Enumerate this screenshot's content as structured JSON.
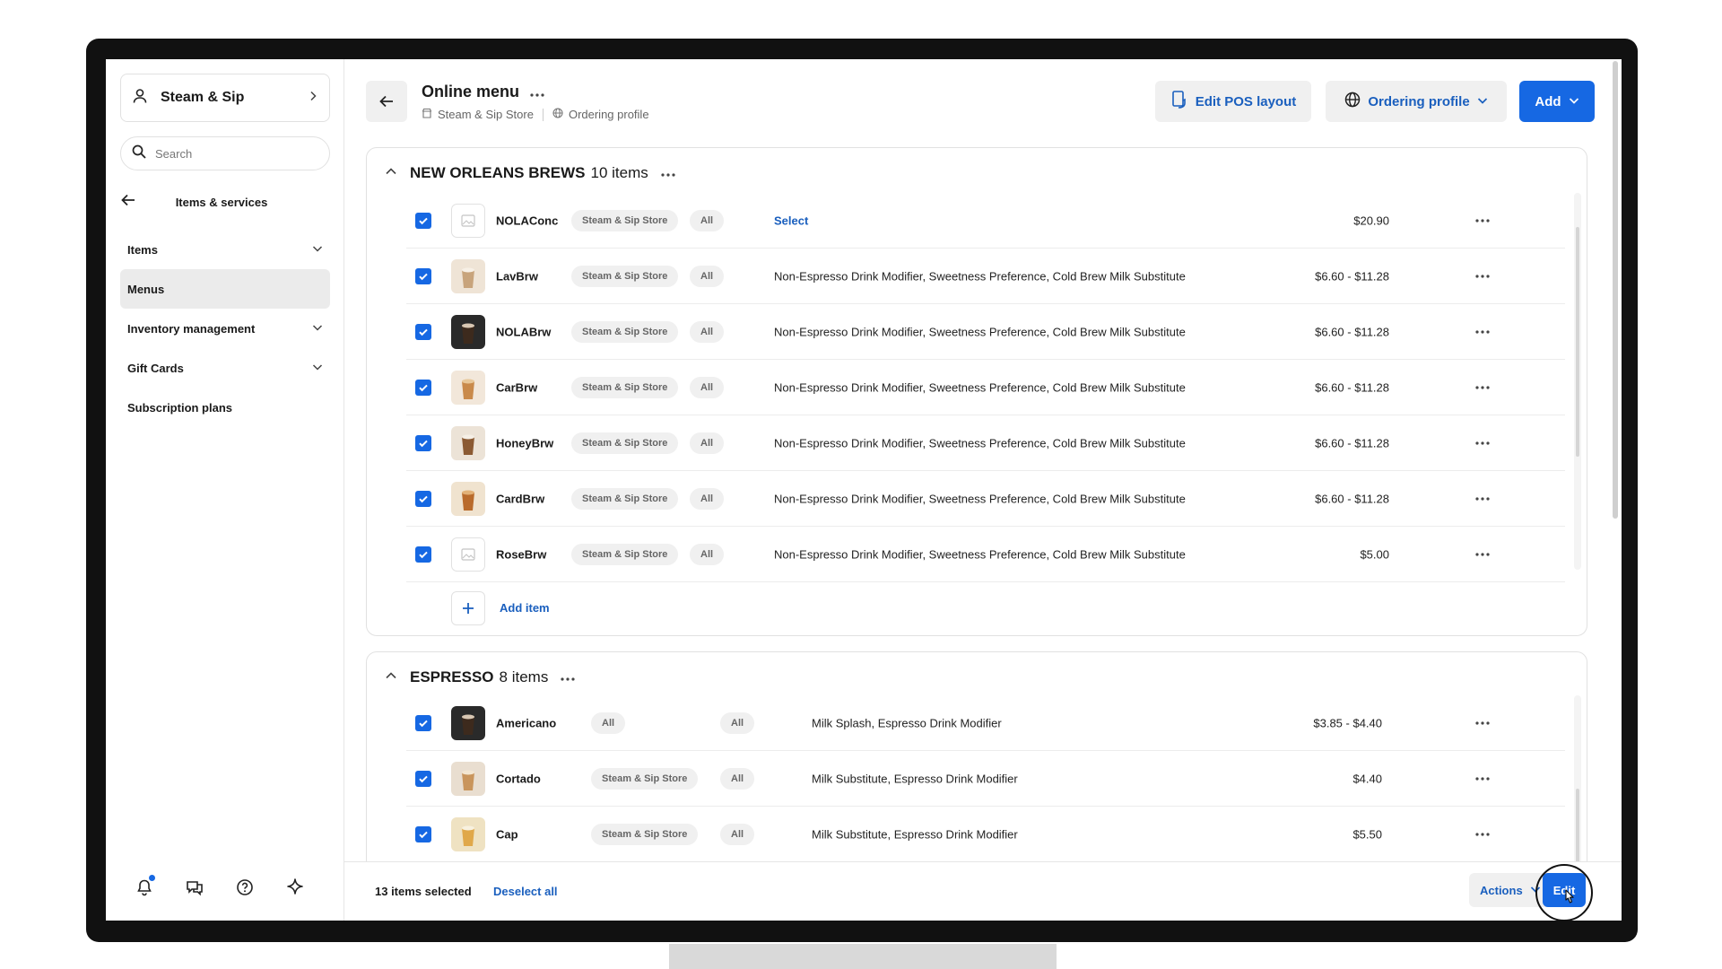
{
  "sidebar": {
    "account_name": "Steam & Sip",
    "search_placeholder": "Search",
    "section_title": "Items & services",
    "nav": [
      {
        "label": "Items",
        "has_chevron": true
      },
      {
        "label": "Menus",
        "has_chevron": false,
        "active": true
      },
      {
        "label": "Inventory management",
        "has_chevron": true
      },
      {
        "label": "Gift Cards",
        "has_chevron": true
      },
      {
        "label": "Subscription plans",
        "has_chevron": false
      }
    ]
  },
  "header": {
    "title": "Online menu",
    "crumb_location": "Steam & Sip Store",
    "crumb_profile": "Ordering profile",
    "edit_pos_label": "Edit POS layout",
    "ordering_profile_label": "Ordering profile",
    "add_label": "Add"
  },
  "sections": [
    {
      "name": "NEW ORLEANS BREWS",
      "count": "10 items",
      "add_item_label": "Add item",
      "rows": [
        {
          "name": "NOLAConc",
          "location": "Steam & Sip Store",
          "visibility": "All",
          "modifiers": "Select",
          "modifiers_is_link": true,
          "price": "$20.90",
          "thumb": "placeholder"
        },
        {
          "name": "LavBrw",
          "location": "Steam & Sip Store",
          "visibility": "All",
          "modifiers": "Non-Espresso Drink Modifier, Sweetness Preference, Cold Brew Milk Substitute",
          "price": "$6.60 - $11.28",
          "thumb": "latte"
        },
        {
          "name": "NOLABrw",
          "location": "Steam & Sip Store",
          "visibility": "All",
          "modifiers": "Non-Espresso Drink Modifier, Sweetness Preference, Cold Brew Milk Substitute",
          "price": "$6.60 - $11.28",
          "thumb": "dark"
        },
        {
          "name": "CarBrw",
          "location": "Steam & Sip Store",
          "visibility": "All",
          "modifiers": "Non-Espresso Drink Modifier, Sweetness Preference, Cold Brew Milk Substitute",
          "price": "$6.60 - $11.28",
          "thumb": "caramel"
        },
        {
          "name": "HoneyBrw",
          "location": "Steam & Sip Store",
          "visibility": "All",
          "modifiers": "Non-Espresso Drink Modifier, Sweetness Preference, Cold Brew Milk Substitute",
          "price": "$6.60 - $11.28",
          "thumb": "honey"
        },
        {
          "name": "CardBrw",
          "location": "Steam & Sip Store",
          "visibility": "All",
          "modifiers": "Non-Espresso Drink Modifier, Sweetness Preference, Cold Brew Milk Substitute",
          "price": "$6.60 - $11.28",
          "thumb": "amber"
        },
        {
          "name": "RoseBrw",
          "location": "Steam & Sip Store",
          "visibility": "All",
          "modifiers": "Non-Espresso Drink Modifier, Sweetness Preference, Cold Brew Milk Substitute",
          "price": "$5.00",
          "thumb": "placeholder"
        }
      ]
    },
    {
      "name": "ESPRESSO",
      "count": "8 items",
      "rows": [
        {
          "name": "Americano",
          "location": "All",
          "visibility": "All",
          "modifiers": "Milk Splash, Espresso Drink Modifier",
          "price": "$3.85 - $4.40",
          "thumb": "dark"
        },
        {
          "name": "Cortado",
          "location": "Steam & Sip Store",
          "visibility": "All",
          "modifiers": "Milk Substitute, Espresso Drink Modifier",
          "price": "$4.40",
          "thumb": "cortado"
        },
        {
          "name": "Cap",
          "location": "Steam & Sip Store",
          "visibility": "All",
          "modifiers": "Milk Substitute, Espresso Drink Modifier",
          "price": "$5.50",
          "thumb": "cap"
        }
      ]
    }
  ],
  "footer": {
    "selected_text": "13 items selected",
    "deselect_label": "Deselect all",
    "actions_label": "Actions",
    "edit_label": "Edit"
  },
  "colors": {
    "accent": "#1668e3",
    "link": "#1a5fbe"
  }
}
